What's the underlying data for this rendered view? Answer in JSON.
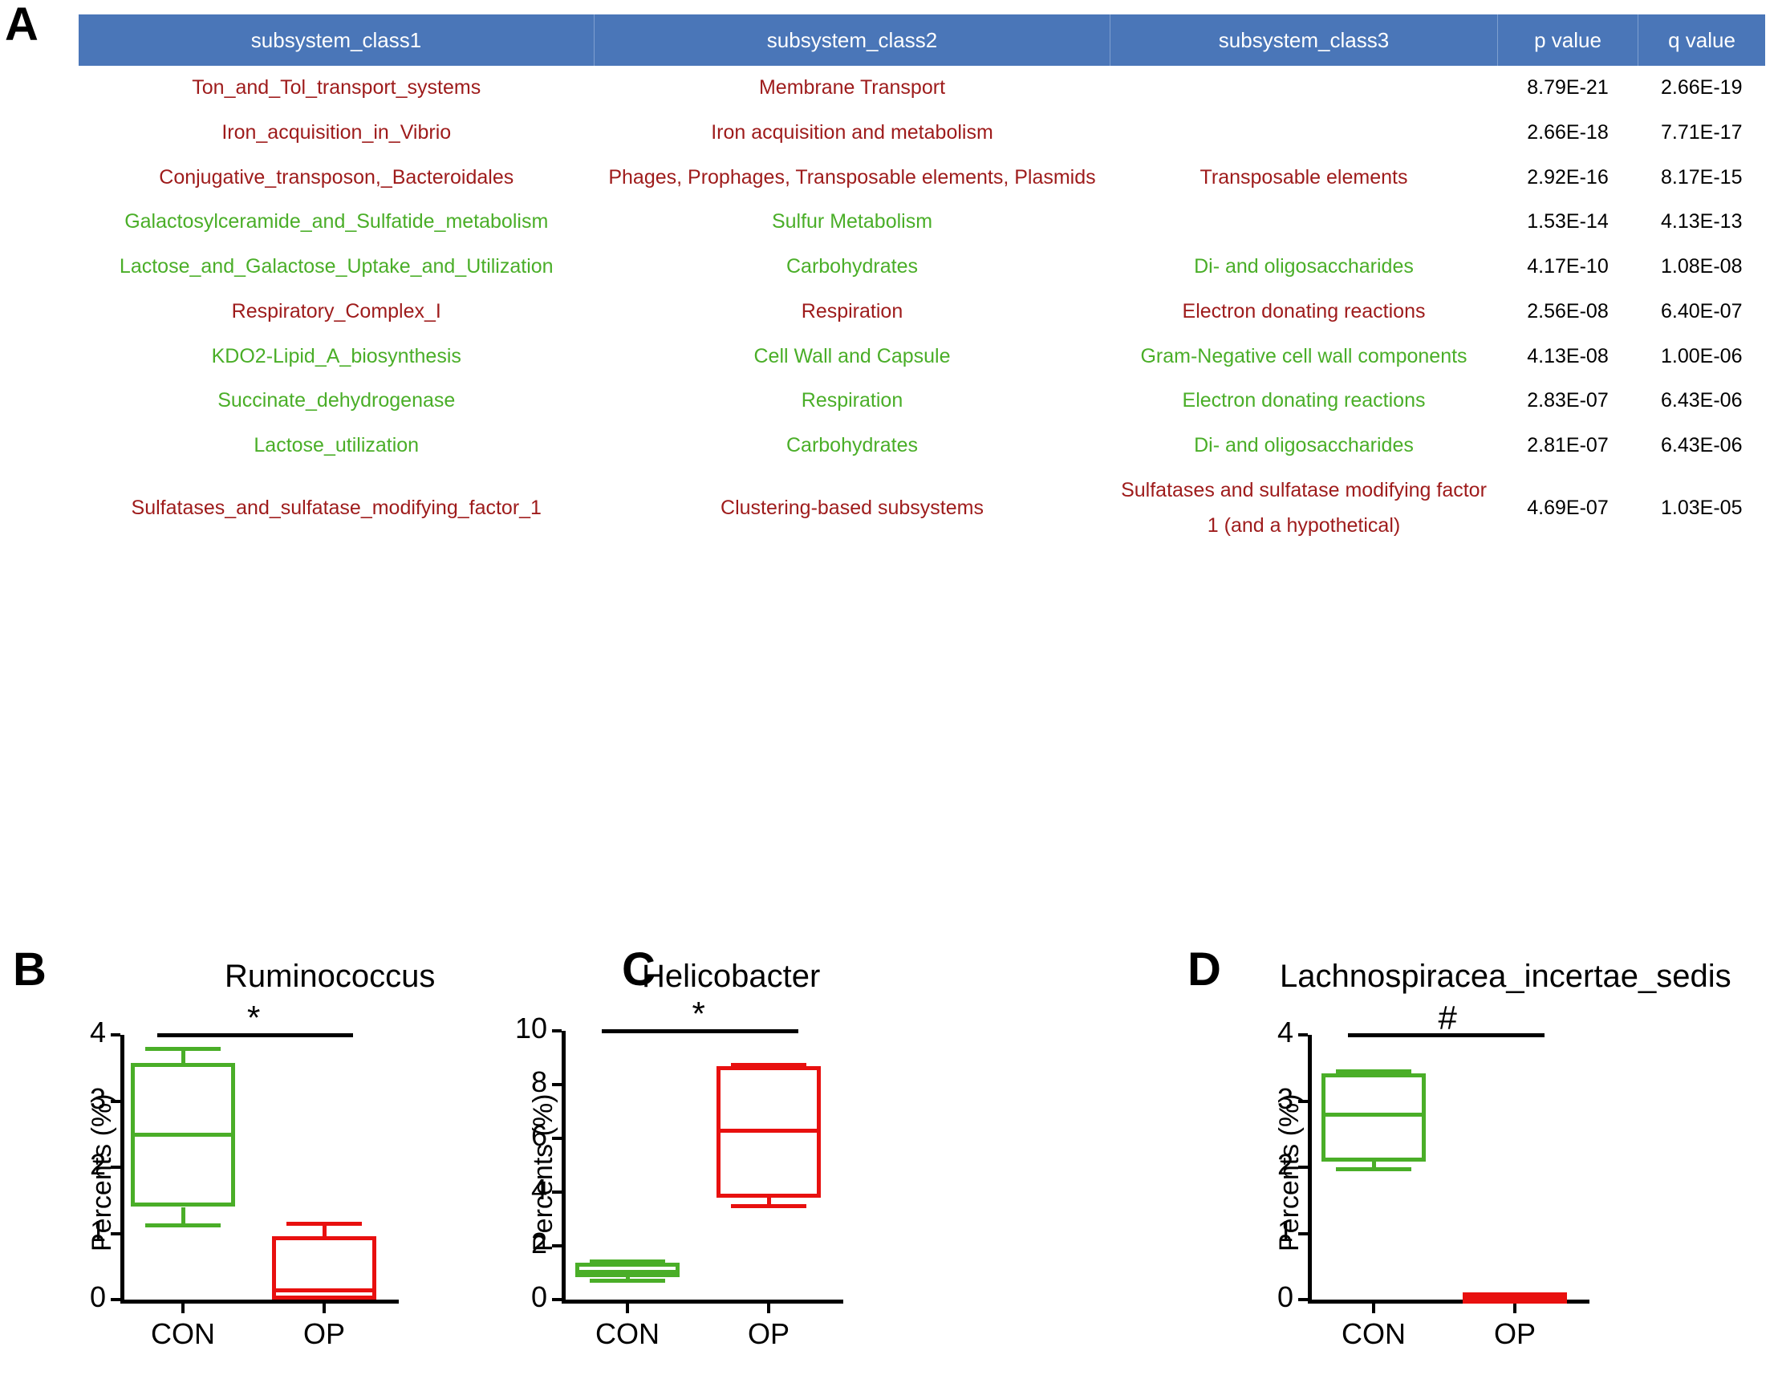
{
  "panels": {
    "a_letter": "A",
    "b_letter": "B",
    "c_letter": "C",
    "d_letter": "D"
  },
  "colors": {
    "header_blue": "#4a76b8",
    "enriched_red": "#9e1b1b",
    "depleted_green": "#4aae28",
    "box_green": "#4aae28",
    "box_red": "#e8100f"
  },
  "table": {
    "headers": [
      "subsystem_class1",
      "subsystem_class2",
      "subsystem_class3",
      "p value",
      "q value"
    ],
    "rows": [
      {
        "class1": "Ton_and_Tol_transport_systems",
        "class2": "Membrane Transport",
        "class3": "",
        "p": "8.79E-21",
        "q": "2.66E-19",
        "direction": "up"
      },
      {
        "class1": "Iron_acquisition_in_Vibrio",
        "class2": "Iron acquisition and metabolism",
        "class3": "",
        "p": "2.66E-18",
        "q": "7.71E-17",
        "direction": "up"
      },
      {
        "class1": "Conjugative_transposon,_Bacteroidales",
        "class2": "Phages, Prophages, Transposable elements, Plasmids",
        "class3": "Transposable elements",
        "p": "2.92E-16",
        "q": "8.17E-15",
        "direction": "up"
      },
      {
        "class1": "Galactosylceramide_and_Sulfatide_metabolism",
        "class2": "Sulfur Metabolism",
        "class3": "",
        "p": "1.53E-14",
        "q": "4.13E-13",
        "direction": "down"
      },
      {
        "class1": "Lactose_and_Galactose_Uptake_and_Utilization",
        "class2": "Carbohydrates",
        "class3": "Di- and oligosaccharides",
        "p": "4.17E-10",
        "q": "1.08E-08",
        "direction": "down"
      },
      {
        "class1": "Respiratory_Complex_I",
        "class2": "Respiration",
        "class3": "Electron donating reactions",
        "p": "2.56E-08",
        "q": "6.40E-07",
        "direction": "up"
      },
      {
        "class1": "KDO2-Lipid_A_biosynthesis",
        "class2": "Cell Wall and Capsule",
        "class3": "Gram-Negative cell wall components",
        "p": "4.13E-08",
        "q": "1.00E-06",
        "direction": "down"
      },
      {
        "class1": "Succinate_dehydrogenase",
        "class2": "Respiration",
        "class3": "Electron donating reactions",
        "p": "2.83E-07",
        "q": "6.43E-06",
        "direction": "down"
      },
      {
        "class1": "Lactose_utilization",
        "class2": "Carbohydrates",
        "class3": "Di- and oligosaccharides",
        "p": "2.81E-07",
        "q": "6.43E-06",
        "direction": "down"
      },
      {
        "class1": "Sulfatases_and_sulfatase_modifying_factor_1",
        "class2": "Clustering-based subsystems",
        "class3": "Sulfatases and sulfatase modifying factor 1 (and a hypothetical)",
        "p": "4.69E-07",
        "q": "1.03E-05",
        "direction": "up"
      }
    ]
  },
  "chart_data": [
    {
      "panel": "B",
      "type": "box",
      "title": "Ruminococcus",
      "ylabel": "Percents (%)",
      "xlabel": "",
      "categories": [
        "CON",
        "OP"
      ],
      "ylim": [
        0,
        4
      ],
      "yticks": [
        0,
        1,
        2,
        3,
        4
      ],
      "ytick_labels": [
        "0",
        "1",
        "2",
        "3",
        "4"
      ],
      "significance": "*",
      "grid": false,
      "series": [
        {
          "name": "CON",
          "color": "#4aae28",
          "min": 1.15,
          "q1": 1.4,
          "median": 2.5,
          "q3": 3.58,
          "max": 3.82
        },
        {
          "name": "OP",
          "color": "#e8100f",
          "min": 0.0,
          "q1": 0.0,
          "median": 0.14,
          "q3": 0.96,
          "max": 1.17
        }
      ]
    },
    {
      "panel": "C",
      "type": "box",
      "title": "Helicobacter",
      "ylabel": "Percents (%)",
      "xlabel": "",
      "categories": [
        "CON",
        "OP"
      ],
      "ylim": [
        0,
        10
      ],
      "yticks": [
        0,
        2,
        4,
        6,
        8,
        10
      ],
      "ytick_labels": [
        "0",
        "2",
        "4",
        "6",
        "8",
        "10"
      ],
      "significance": "*",
      "grid": false,
      "series": [
        {
          "name": "CON",
          "color": "#4aae28",
          "min": 0.78,
          "q1": 0.85,
          "median": 1.05,
          "q3": 1.38,
          "max": 1.48
        },
        {
          "name": "OP",
          "color": "#e8100f",
          "min": 3.55,
          "q1": 3.78,
          "median": 6.3,
          "q3": 8.7,
          "max": 8.82
        }
      ]
    },
    {
      "panel": "D",
      "type": "box",
      "title": "Lachnospiracea_incertae_sedis",
      "ylabel": "Percents (%)",
      "xlabel": "",
      "categories": [
        "CON",
        "OP"
      ],
      "ylim": [
        0,
        4
      ],
      "yticks": [
        0,
        1,
        2,
        3,
        4
      ],
      "ytick_labels": [
        "0",
        "1",
        "2",
        "3",
        "4"
      ],
      "significance": "#",
      "grid": false,
      "series": [
        {
          "name": "CON",
          "color": "#4aae28",
          "min": 2.0,
          "q1": 2.08,
          "median": 2.8,
          "q3": 3.42,
          "max": 3.48
        },
        {
          "name": "OP",
          "color": "#e8100f",
          "min": 0.02,
          "q1": 0.03,
          "median": 0.05,
          "q3": 0.07,
          "max": 0.08
        }
      ]
    }
  ]
}
